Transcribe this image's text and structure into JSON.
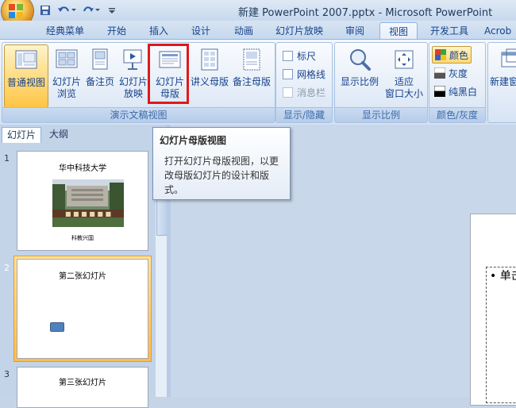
{
  "window": {
    "title": "新建 PowerPoint 2007.pptx - Microsoft PowerPoint",
    "quick_access": [
      "save-icon",
      "undo-icon",
      "redo-icon",
      "customize-icon"
    ]
  },
  "tabs": [
    "经典菜单",
    "开始",
    "插入",
    "设计",
    "动画",
    "幻灯片放映",
    "审阅",
    "视图",
    "开发工具",
    "Acrob"
  ],
  "active_tab": "视图",
  "ribbon": {
    "presentation_views": {
      "label": "演示文稿视图",
      "buttons": [
        {
          "label": "普通视图",
          "icon": "normal-view-icon"
        },
        {
          "label": "幻灯片浏览",
          "line1": "幻灯片",
          "line2": "浏览",
          "icon": "slide-sorter-icon"
        },
        {
          "label": "备注页",
          "icon": "notes-page-icon"
        },
        {
          "label": "幻灯片放映",
          "line1": "幻灯片",
          "line2": "放映",
          "icon": "slideshow-icon"
        },
        {
          "label": "幻灯片母版",
          "line1": "幻灯片",
          "line2": "母版",
          "icon": "slide-master-icon"
        },
        {
          "label": "讲义母版",
          "visible_text": "讲义母版",
          "icon": "handout-master-icon"
        },
        {
          "label": "备注母版",
          "icon": "notes-master-icon"
        }
      ]
    },
    "show_hide": {
      "label": "显示/隐藏",
      "items": [
        {
          "label": "标尺",
          "enabled": true
        },
        {
          "label": "网格线",
          "enabled": true
        },
        {
          "label": "消息栏",
          "enabled": false
        }
      ]
    },
    "zoom": {
      "label": "显示比例",
      "buttons": [
        {
          "label": "显示比例",
          "icon": "zoom-icon"
        },
        {
          "label": "适应窗口大小",
          "line1": "适应",
          "line2": "窗口大小",
          "icon": "fit-window-icon"
        }
      ]
    },
    "color": {
      "label": "颜色/灰度",
      "options": [
        {
          "label": "颜色",
          "selected": true
        },
        {
          "label": "灰度",
          "selected": false
        },
        {
          "label": "纯黑白",
          "selected": false
        }
      ]
    },
    "window": {
      "button_label": "新建窗",
      "icon": "new-window-icon"
    }
  },
  "tooltip": {
    "title": "幻灯片母版视图",
    "body": "打开幻灯片母版视图，以更改母版幻灯片的设计和版式。"
  },
  "panel_tabs": [
    "幻灯片",
    "大纲"
  ],
  "slides": [
    {
      "number": "1",
      "title": "华中科技大学",
      "caption": "科教兴国"
    },
    {
      "number": "2",
      "title": "第二张幻灯片"
    },
    {
      "number": "3",
      "title": "第三张幻灯片"
    }
  ],
  "main_slide": {
    "bullet_text": "单击"
  },
  "colors": {
    "accent_highlight": "#ffd878",
    "selection_red": "#e0191b"
  }
}
